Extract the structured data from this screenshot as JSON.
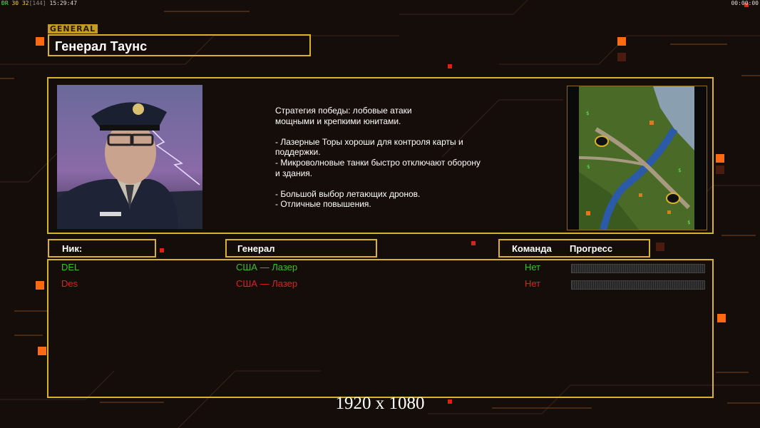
{
  "hud": {
    "fps_label": "ÐR",
    "fps_value": "30",
    "ping": "32",
    "frame": "[144]",
    "clock": "15:29:47",
    "timer": "00:00:00"
  },
  "general": {
    "tag": "GENERAL",
    "name": "Генерал Таунс",
    "description": "Стратегия победы: лобовые атаки\nмощными и крепкими юнитами.\n\n- Лазерные Торы хороши для контроля карты и\n поддержки.\n- Микроволновые танки быстро отключают оборону\n и здания.\n\n- Большой выбор летающих дронов.\n- Отличные повышения."
  },
  "columns": {
    "nick": "Ник:",
    "general": "Генерал",
    "team": "Команда",
    "progress": "Прогресс"
  },
  "players": [
    {
      "nick": "DEL",
      "general": "США — Лазер",
      "team": "Нет",
      "color": "#3fbf2a",
      "progress": 0
    },
    {
      "nick": "Des",
      "general": "США — Лазер",
      "team": "Нет",
      "color": "#e02020",
      "progress": 0
    }
  ],
  "colors": {
    "accent": "#d8b22a",
    "orange": "#ff6a10"
  },
  "footer": "1920 x 1080"
}
